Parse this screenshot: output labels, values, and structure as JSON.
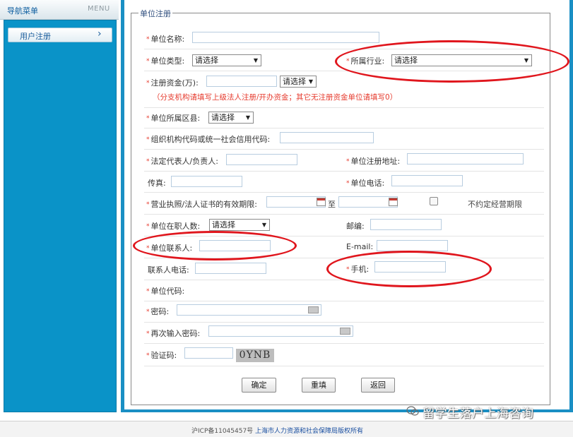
{
  "nav": {
    "title": "导航菜单",
    "menu_label": "MENU",
    "items": [
      {
        "label": "用户注册",
        "icon": "chevron-right-icon"
      }
    ]
  },
  "form": {
    "legend": "单位注册",
    "company_name": {
      "label": "单位名称:",
      "value": ""
    },
    "company_type": {
      "label": "单位类型:",
      "selected": "请选择"
    },
    "industry": {
      "label": "所属行业:",
      "selected": "请选择"
    },
    "capital": {
      "label": "注册资金(万):",
      "value": "",
      "unit_selected": "请选择",
      "note": "（分支机构请填写上级法人注册/开办资金；其它无注册资金单位请填写0）"
    },
    "district": {
      "label": "单位所属区县:",
      "selected": "请选择"
    },
    "org_code": {
      "label": "组织机构代码或统一社会信用代码:",
      "value": ""
    },
    "legal_rep": {
      "label": "法定代表人/负责人:",
      "value": ""
    },
    "reg_address": {
      "label": "单位注册地址:",
      "value": ""
    },
    "fax": {
      "label": "传真:",
      "value": ""
    },
    "phone": {
      "label": "单位电话:",
      "value": ""
    },
    "license_period": {
      "label": "营业执照/法人证书的有效期限:",
      "to": "至",
      "unlimited_label": "不约定经营期限",
      "unlimited_checked": false
    },
    "staff_count": {
      "label": "单位在职人数:",
      "selected": "请选择"
    },
    "postcode": {
      "label": "邮编:",
      "value": ""
    },
    "contact": {
      "label": "单位联系人:",
      "value": ""
    },
    "email": {
      "label": "E-mail:",
      "value": ""
    },
    "contact_phone": {
      "label": "联系人电话:",
      "value": ""
    },
    "mobile": {
      "label": "手机:",
      "value": ""
    },
    "unit_code": {
      "label": "单位代码:"
    },
    "password": {
      "label": "密码:",
      "value": ""
    },
    "password_confirm": {
      "label": "再次输入密码:",
      "value": ""
    },
    "captcha": {
      "label": "验证码:",
      "value": "",
      "image_text": "0YNB"
    },
    "required_mark": "*",
    "select_arrow": "▼",
    "buttons": {
      "confirm": "确定",
      "reset": "重填",
      "back": "返回"
    }
  },
  "footer": {
    "icp": "沪ICP备11045457号",
    "copyright": "上海市人力资源和社会保障局版权所有"
  },
  "watermark": {
    "text": "留学生落户上海咨询"
  },
  "colors": {
    "nav_blue": "#0a93c8",
    "frame_blue": "#1a8fc4",
    "required_red": "#e63b2e",
    "highlight_red": "#e0161d",
    "note_red": "#e63b2e"
  }
}
